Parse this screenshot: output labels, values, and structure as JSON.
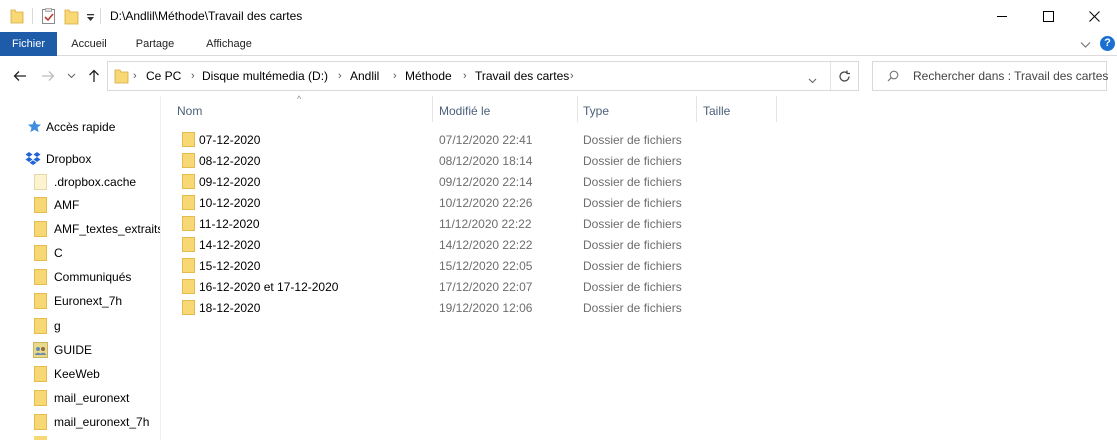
{
  "window": {
    "title": "D:\\Andlil\\Méthode\\Travail des cartes"
  },
  "ribbon": {
    "tabs": [
      "Fichier",
      "Accueil",
      "Partage",
      "Affichage"
    ],
    "help_label": "?"
  },
  "breadcrumb": [
    "Ce PC",
    "Disque multémedia (D:)",
    "Andlil",
    "Méthode",
    "Travail des cartes"
  ],
  "search": {
    "placeholder": "Rechercher dans : Travail des cartes"
  },
  "sidebar": {
    "items": [
      {
        "label": "Accès rapide",
        "icon": "star-icon"
      },
      {
        "label": "Dropbox",
        "icon": "dropbox-icon"
      },
      {
        "label": ".dropbox.cache",
        "icon": "folder-icon"
      },
      {
        "label": "AMF",
        "icon": "folder-icon"
      },
      {
        "label": "AMF_textes_extraits",
        "icon": "folder-icon"
      },
      {
        "label": "C",
        "icon": "folder-icon"
      },
      {
        "label": "Communiqués",
        "icon": "folder-icon"
      },
      {
        "label": "Euronext_7h",
        "icon": "folder-icon"
      },
      {
        "label": "g",
        "icon": "folder-icon"
      },
      {
        "label": "GUIDE",
        "icon": "shared-folder-icon"
      },
      {
        "label": "KeeWeb",
        "icon": "folder-icon"
      },
      {
        "label": "mail_euronext",
        "icon": "folder-icon"
      },
      {
        "label": "mail_euronext_7h",
        "icon": "folder-icon"
      }
    ]
  },
  "columns": {
    "name": "Nom",
    "modified": "Modifié le",
    "type": "Type",
    "size": "Taille"
  },
  "files": [
    {
      "name": "07-12-2020",
      "modified": "07/12/2020 22:41",
      "type": "Dossier de fichiers"
    },
    {
      "name": "08-12-2020",
      "modified": "08/12/2020 18:14",
      "type": "Dossier de fichiers"
    },
    {
      "name": "09-12-2020",
      "modified": "09/12/2020 22:14",
      "type": "Dossier de fichiers"
    },
    {
      "name": "10-12-2020",
      "modified": "10/12/2020 22:26",
      "type": "Dossier de fichiers"
    },
    {
      "name": "11-12-2020",
      "modified": "11/12/2020 22:22",
      "type": "Dossier de fichiers"
    },
    {
      "name": "14-12-2020",
      "modified": "14/12/2020 22:22",
      "type": "Dossier de fichiers"
    },
    {
      "name": "15-12-2020",
      "modified": "15/12/2020 22:05",
      "type": "Dossier de fichiers"
    },
    {
      "name": "16-12-2020 et 17-12-2020",
      "modified": "17/12/2020 22:07",
      "type": "Dossier de fichiers"
    },
    {
      "name": "18-12-2020",
      "modified": "19/12/2020 12:06",
      "type": "Dossier de fichiers"
    }
  ],
  "colors": {
    "accent": "#1e5ba8",
    "folder": "#f8d775",
    "header_text": "#4c607a",
    "muted_text": "#6d6d6d"
  }
}
